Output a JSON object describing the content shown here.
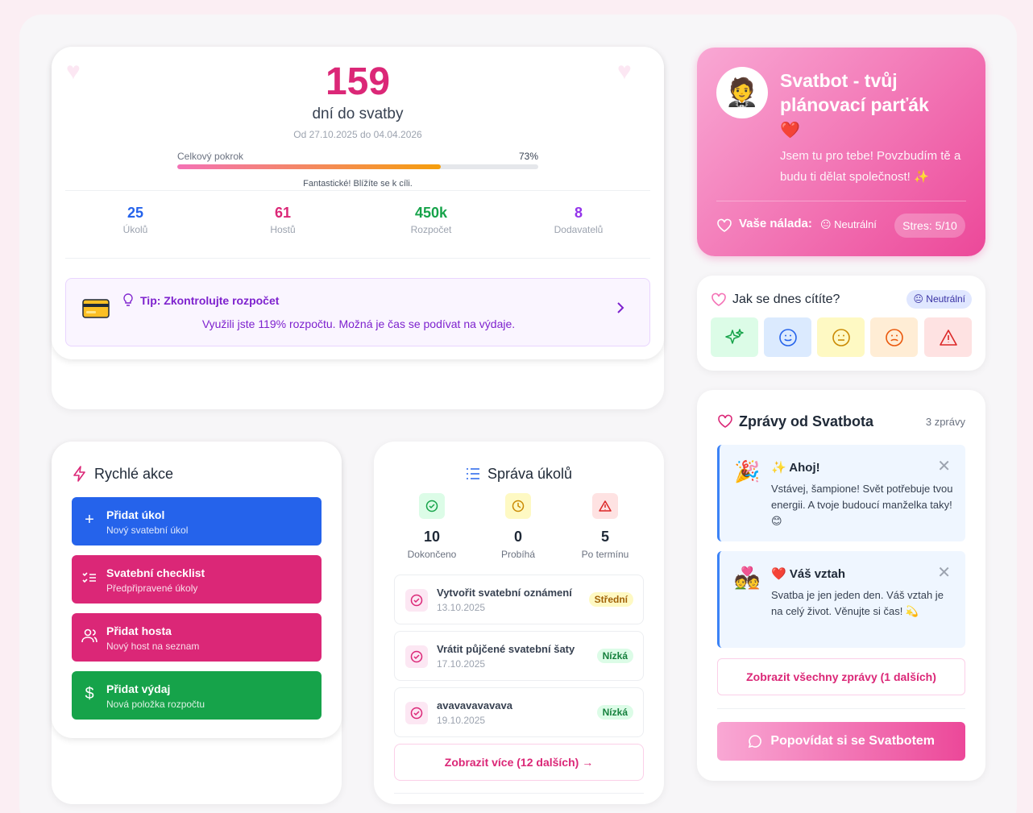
{
  "countdown": {
    "days": "159",
    "days_label": "dní do svatby",
    "date_range": "Od 27.10.2025 do 04.04.2026",
    "progress_label": "Celkový pokrok",
    "progress_pct_text": "73%",
    "progress_value": 0.73,
    "progress_message": "Fantastické! Blížíte se k cíli.",
    "stats": [
      {
        "value": "25",
        "label": "Úkolů",
        "color": "#2563eb"
      },
      {
        "value": "61",
        "label": "Hostů",
        "color": "#db2777"
      },
      {
        "value": "450k",
        "label": "Rozpočet",
        "color": "#16a34a"
      },
      {
        "value": "8",
        "label": "Dodavatelů",
        "color": "#9333ea"
      }
    ],
    "tip": {
      "title": "Tip: Zkontrolujte rozpočet",
      "text": "Využili jste 119% rozpočtu. Možná je čas se podívat na výdaje.",
      "icon": "credit-card-icon"
    }
  },
  "quick_actions": {
    "title": "Rychlé akce",
    "items": [
      {
        "title": "Přidat úkol",
        "subtitle": "Nový svatební úkol",
        "color": "#2563eb",
        "icon": "plus-icon"
      },
      {
        "title": "Svatební checklist",
        "subtitle": "Předpřipravené úkoly",
        "color": "#db2777",
        "icon": "checklist-icon"
      },
      {
        "title": "Přidat hosta",
        "subtitle": "Nový host na seznam",
        "color": "#db2777",
        "icon": "users-icon"
      },
      {
        "title": "Přidat výdaj",
        "subtitle": "Nová položka rozpočtu",
        "color": "#16a34a",
        "icon": "dollar-icon"
      }
    ]
  },
  "tasks": {
    "title": "Správa úkolů",
    "stats": [
      {
        "value": "10",
        "label": "Dokončeno"
      },
      {
        "value": "0",
        "label": "Probíhá"
      },
      {
        "value": "5",
        "label": "Po termínu"
      }
    ],
    "items": [
      {
        "title": "Vytvořit svatební oznámení",
        "date": "13.10.2025",
        "priority": "Střední"
      },
      {
        "title": "Vrátit půjčené svatební šaty",
        "date": "17.10.2025",
        "priority": "Nízká"
      },
      {
        "title": "avavavavavava",
        "date": "19.10.2025",
        "priority": "Nízká"
      }
    ],
    "more_label": "Zobrazit více (12 dalších)"
  },
  "svatbot": {
    "title": "Svatbot - tvůj plánovací parťák",
    "title_emoji": "❤️",
    "subtitle": "Jsem tu pro tebe! Povzbudím tě a budu ti dělat společnost! ✨",
    "mood_label": "Vaše nálada:",
    "mood_value": "😐 Neutrální",
    "stress": "Stres: 5/10"
  },
  "feel": {
    "title": "Jak se dnes cítíte?",
    "badge": "😐 Neutrální"
  },
  "messages": {
    "title": "Zprávy od Svatbota",
    "count": "3 zprávy",
    "items": [
      {
        "emoji": "🎉",
        "title": "✨ Ahoj!",
        "body": "Vstávej, šampione! Svět potřebuje tvou energii. A tvoje budoucí manželka taky! 😊"
      },
      {
        "emoji": "💑",
        "title": "❤️ Váš vztah",
        "body": "Svatba je jen jeden den. Váš vztah je na celý život. Věnujte si čas! 💫"
      }
    ],
    "show_all": "Zobrazit všechny zprávy (1 dalších)",
    "chat_button": "Popovídat si se Svatbotem"
  }
}
